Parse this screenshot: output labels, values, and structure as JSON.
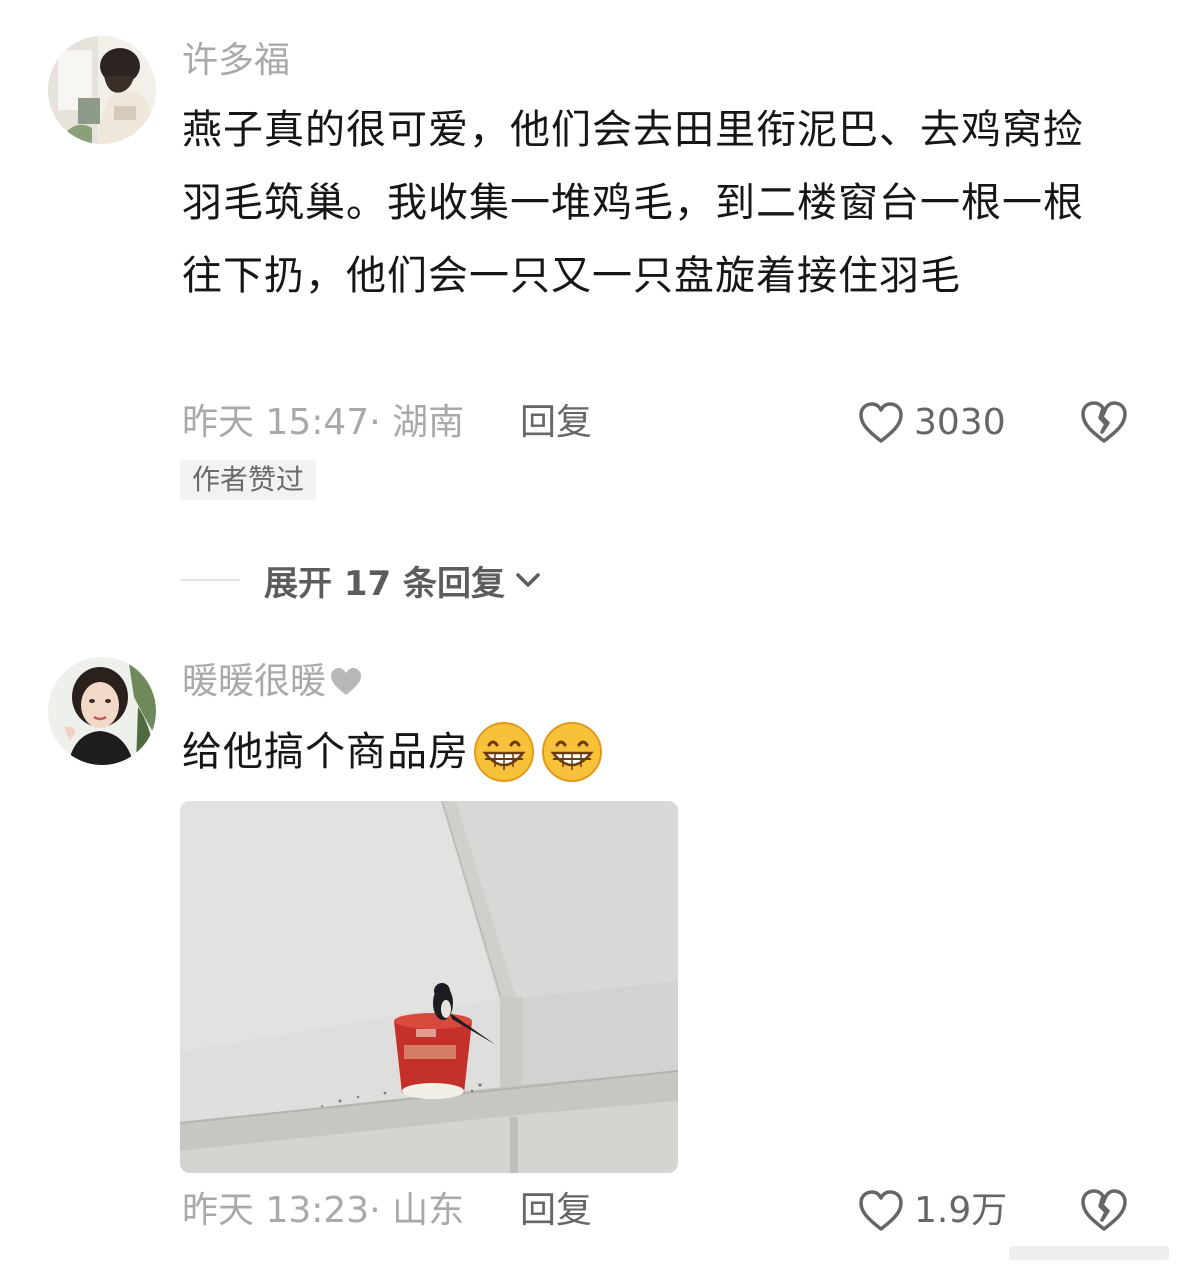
{
  "comments": [
    {
      "username": "许多福",
      "text": "燕子真的很可爱，他们会去田里衔泥巴、去鸡窝捡羽毛筑巢。我收集一堆鸡毛，到二楼窗台一根一根往下扔，他们会一只又一只盘旋着接住羽毛",
      "meta": "昨天 15:47· 湖南",
      "reply_label": "回复",
      "like_count": "3030",
      "badge": "作者赞过",
      "avatar_icon": "user-avatar-photo"
    },
    {
      "username": "暖暖很暖",
      "username_icon": "heart-icon",
      "text": "给他搞个商品房",
      "emojis": [
        "grinning-face-emoji",
        "grinning-face-emoji"
      ],
      "image_icon": "swallow-nest-photo",
      "meta": "昨天 13:23· 山东",
      "reply_label": "回复",
      "like_count": "1.9万",
      "avatar_icon": "user-avatar-photo"
    }
  ],
  "expand_replies": {
    "label": "展开 17 条回复",
    "icon": "chevron-down-icon"
  },
  "colors": {
    "username": "#a9a9ab",
    "text": "#161616",
    "meta": "#a9a9ab",
    "action": "#666668",
    "badge_bg": "#f2f2f4"
  }
}
